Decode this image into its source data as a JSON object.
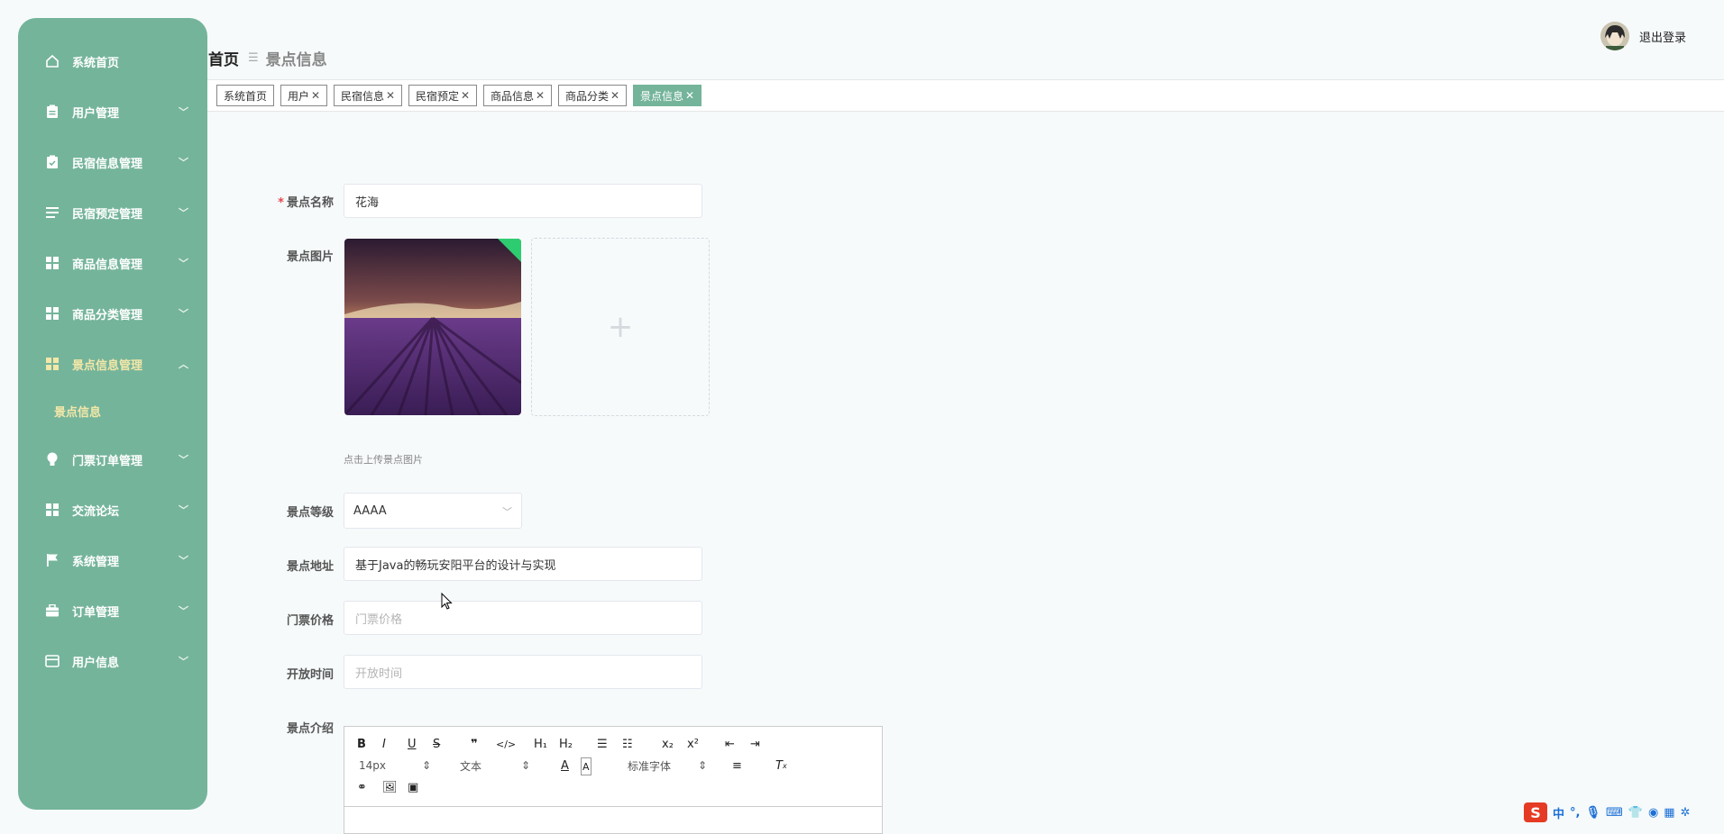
{
  "sidebar": {
    "items": [
      {
        "label": "系统首页",
        "icon": "home-icon",
        "chevron": ""
      },
      {
        "label": "用户管理",
        "icon": "clipboard-icon",
        "chevron": "﹀"
      },
      {
        "label": "民宿信息管理",
        "icon": "clipboard-check-icon",
        "chevron": "﹀"
      },
      {
        "label": "民宿预定管理",
        "icon": "list-icon",
        "chevron": "﹀"
      },
      {
        "label": "商品信息管理",
        "icon": "grid-icon",
        "chevron": "﹀"
      },
      {
        "label": "商品分类管理",
        "icon": "grid-icon",
        "chevron": "﹀"
      },
      {
        "label": "景点信息管理",
        "icon": "grid-icon",
        "chevron": "︿"
      },
      {
        "label": "门票订单管理",
        "icon": "bulb-icon",
        "chevron": "﹀"
      },
      {
        "label": "交流论坛",
        "icon": "grid-icon",
        "chevron": "﹀"
      },
      {
        "label": "系统管理",
        "icon": "flag-icon",
        "chevron": "﹀"
      },
      {
        "label": "订单管理",
        "icon": "briefcase-icon",
        "chevron": "﹀"
      },
      {
        "label": "用户信息",
        "icon": "card-icon",
        "chevron": "﹀"
      }
    ],
    "submenu": {
      "label": "景点信息"
    }
  },
  "header": {
    "breadcrumb_home": "首页",
    "breadcrumb_sep": "☰",
    "breadcrumb_current": "景点信息",
    "logout_label": "退出登录"
  },
  "tags": [
    {
      "label": "系统首页",
      "closable": false
    },
    {
      "label": "用户",
      "closable": true
    },
    {
      "label": "民宿信息",
      "closable": true
    },
    {
      "label": "民宿预定",
      "closable": true
    },
    {
      "label": "商品信息",
      "closable": true
    },
    {
      "label": "商品分类",
      "closable": true
    },
    {
      "label": "景点信息",
      "closable": true,
      "active": true
    }
  ],
  "tag_close": "✕",
  "form": {
    "name_label": "景点名称",
    "name_value": "花海",
    "image_label": "景点图片",
    "image_hint": "点击上传景点图片",
    "upload_plus": "+",
    "level_label": "景点等级",
    "level_value": "AAAA",
    "address_label": "景点地址",
    "address_value": "基于Java的畅玩安阳平台的设计与实现",
    "price_label": "门票价格",
    "price_placeholder": "门票价格",
    "open_label": "开放时间",
    "open_placeholder": "开放时间",
    "intro_label": "景点介绍",
    "required_mark": "*"
  },
  "editor": {
    "font_size": "14px",
    "header_select": "文本",
    "font_family": "标准字体"
  },
  "tray": {
    "ime": "中",
    "logo": "S"
  },
  "colors": {
    "sidebar": "#74b49b",
    "active_tag": "#74b49b",
    "required": "#e5484d"
  }
}
